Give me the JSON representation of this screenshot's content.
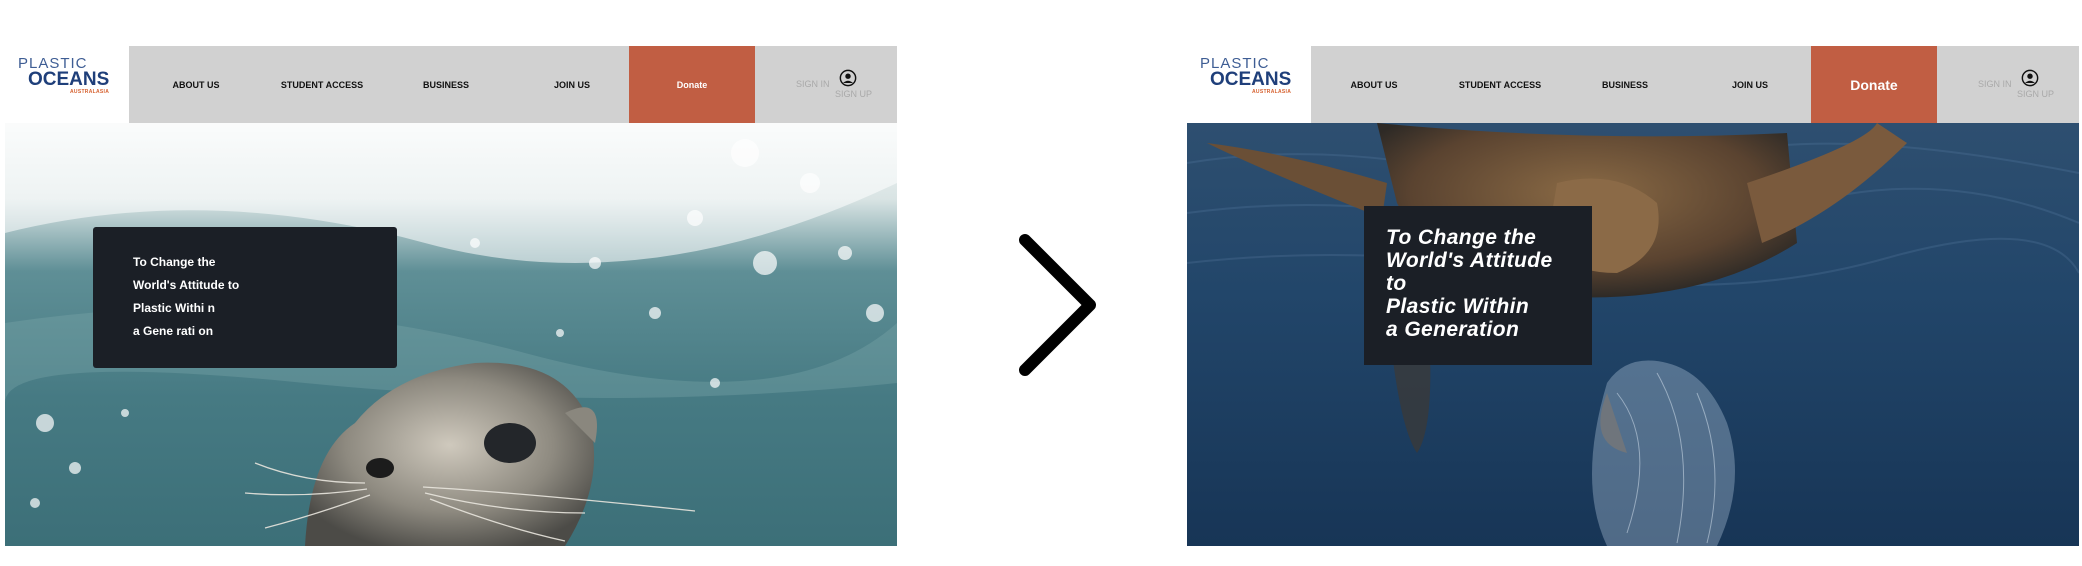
{
  "brand": {
    "logo_line1": "PLASTIC",
    "logo_line2": "OCEANS",
    "logo_line3": "AUSTRALASIA"
  },
  "nav": {
    "items": [
      "ABOUT US",
      "STUDENT ACCESS",
      "BUSINESS",
      "JOIN US"
    ],
    "donate": "Donate",
    "sign_in": "SIGN IN",
    "sign_up": "SIGN UP"
  },
  "before": {
    "headline_lines": [
      "To Change the",
      "World's Attitude to",
      "Plastic Withi n",
      "a Gene rati on"
    ]
  },
  "after": {
    "headline_lines": [
      "To  Change  the",
      "World's  Attitude",
      "to",
      "Plastic  Within",
      "a  Generation"
    ]
  },
  "colors": {
    "nav_background": "#d1d1d1",
    "donate_background": "#c15e43",
    "text_box_background": "#1b1f26",
    "logo_blue": "#1f3f7a",
    "logo_orange": "#d6612f"
  },
  "icons": {
    "user": "user-circle-icon",
    "next": "chevron-right-icon"
  },
  "images": {
    "left_hero": "sea lion swimming underwater",
    "right_hero": "sea turtle with plastic bag underwater"
  }
}
